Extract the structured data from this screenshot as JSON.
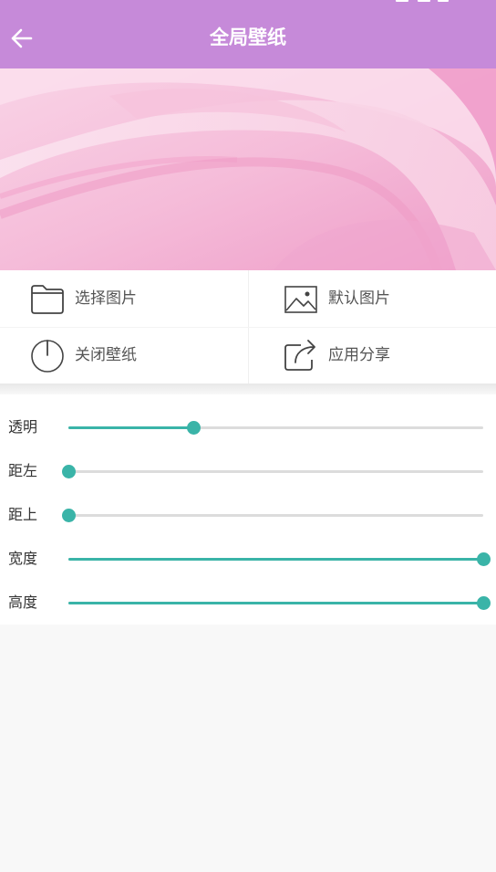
{
  "header": {
    "title": "全局壁纸",
    "background": "#c68ad9",
    "back_icon": "arrow-left-icon"
  },
  "preview": {
    "image": "pink-abstract-wallpaper"
  },
  "actions": [
    {
      "label": "选择图片",
      "icon": "folder-icon"
    },
    {
      "label": "默认图片",
      "icon": "image-icon"
    },
    {
      "label": "关闭壁纸",
      "icon": "power-icon"
    },
    {
      "label": "应用分享",
      "icon": "share-icon"
    }
  ],
  "sliders": [
    {
      "label": "透明",
      "value": 0.3
    },
    {
      "label": "距左",
      "value": 0.0
    },
    {
      "label": "距上",
      "value": 0.0
    },
    {
      "label": "宽度",
      "value": 1.0
    },
    {
      "label": "高度",
      "value": 1.0
    }
  ],
  "colors": {
    "accent": "#3ab4a8",
    "track": "#dcdcdc"
  }
}
